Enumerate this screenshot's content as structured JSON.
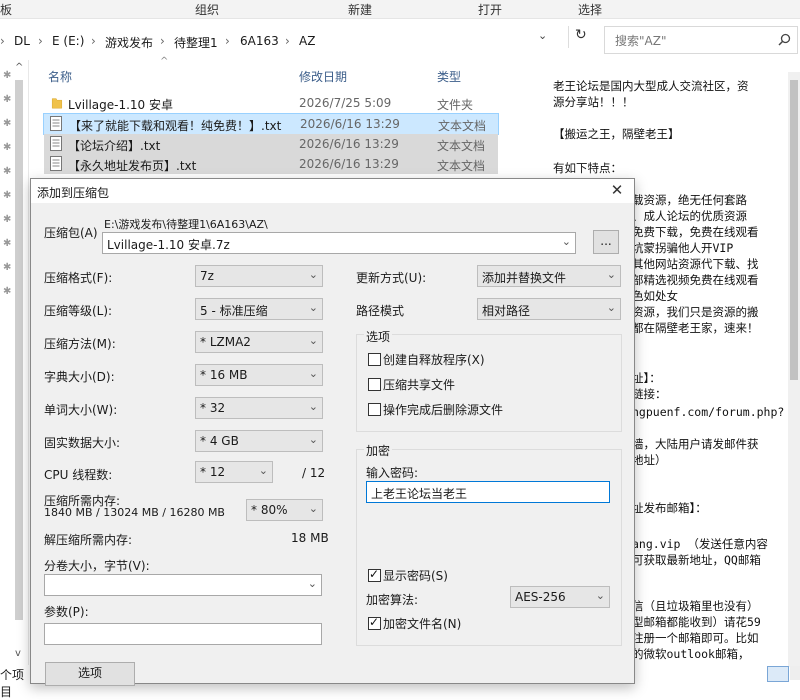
{
  "ribbon": {
    "items": [
      "板",
      "组织",
      "新建",
      "打开",
      "选择"
    ]
  },
  "address": {
    "segments": [
      "DL",
      "E (E:)",
      "游戏发布",
      "待整理1",
      "6A163",
      "AZ"
    ],
    "search_placeholder": "搜索\"AZ\""
  },
  "file_list": {
    "headers": {
      "name": "名称",
      "date": "修改日期",
      "type": "类型"
    },
    "rows": [
      {
        "name": "Lvillage-1.10 安卓",
        "date": "2026/7/25 5:09",
        "type": "文件夹",
        "icon": "folder-icon"
      },
      {
        "name": "【来了就能下载和观看！纯免费！】.txt",
        "date": "2026/6/16 13:29",
        "type": "文本文档",
        "icon": "text-file-icon"
      },
      {
        "name": "【论坛介绍】.txt",
        "date": "2026/6/16 13:29",
        "type": "文本文档",
        "icon": "text-file-icon"
      },
      {
        "name": "【永久地址发布页】.txt",
        "date": "2026/6/16 13:29",
        "type": "文本文档",
        "icon": "text-file-icon"
      }
    ]
  },
  "status": {
    "items_label": "个项目"
  },
  "preview": {
    "lines": [
      "老王论坛是国内大型成人交流社区，资",
      "源分享站！！！",
      "",
      "【搬运之王，隔壁老王】",
      "",
      "有如下特点：",
      "",
      "载资源，绝无任何套路",
      "、成人论坛的优质资源",
      "免费下载，免费在线观看",
      "坑蒙拐骗他人开VIP",
      "其他网站资源代下载、找",
      "部精选视频免费在线观看",
      "色如处女",
      "资源，我们只是资源的搬",
      "都在隔壁老王家，速来！",
      "",
      "",
      "址】：",
      "链接：",
      "ngpuenf.com/forum.php?",
      "",
      "墙，大陆用户请发邮件获",
      "地址）",
      "",
      "",
      "址发布邮箱】：",
      "",
      "ang.vip  （发送任意内容",
      "可获取最新地址，QQ邮箱",
      "",
      "",
      "信（且垃圾箱里也没有）",
      "型邮箱都能收到）请花59",
      "注册一个邮箱即可。比如",
      "的微软outlook邮箱，"
    ]
  },
  "dialog": {
    "title": "添加到压缩包",
    "archive_label": "压缩包(A)",
    "archive_path": "E:\\游戏发布\\待整理1\\6A163\\AZ\\",
    "archive_name": "Lvillage-1.10 安卓.7z",
    "browse_label": "...",
    "left_fields": [
      {
        "label": "压缩格式(F):",
        "value": "7z",
        "gray": false
      },
      {
        "label": "压缩等级(L):",
        "value": "5 - 标准压缩",
        "gray": false
      },
      {
        "label": "压缩方法(M):",
        "value": "* LZMA2",
        "gray": true
      },
      {
        "label": "字典大小(D):",
        "value": "* 16 MB",
        "gray": true
      },
      {
        "label": "单词大小(W):",
        "value": "* 32",
        "gray": true
      },
      {
        "label": "固实数据大小:",
        "value": "* 4 GB",
        "gray": true
      }
    ],
    "threads": {
      "label": "CPU 线程数:",
      "value": "* 12",
      "max": "/ 12"
    },
    "memory": {
      "label": "压缩所需内存:",
      "detail": "1840 MB / 13024 MB / 16280 MB",
      "percent": "* 80%"
    },
    "decompress_memory": {
      "label": "解压缩所需内存:",
      "value": "18 MB"
    },
    "split": {
      "label": "分卷大小，字节(V):"
    },
    "params": {
      "label": "参数(P):"
    },
    "options_button": "选项",
    "update_mode": {
      "label": "更新方式(U):",
      "value": "添加并替换文件"
    },
    "path_mode": {
      "label": "路径模式",
      "value": "相对路径"
    },
    "options_group": {
      "title": "选项",
      "items": [
        "创建自释放程序(X)",
        "压缩共享文件",
        "操作完成后删除源文件"
      ]
    },
    "encryption": {
      "title": "加密",
      "password_label": "输入密码:",
      "password_value": "上老王论坛当老王",
      "show_password": "显示密码(S)",
      "method_label": "加密算法:",
      "method_value": "AES-256",
      "encrypt_names": "加密文件名(N)"
    }
  }
}
